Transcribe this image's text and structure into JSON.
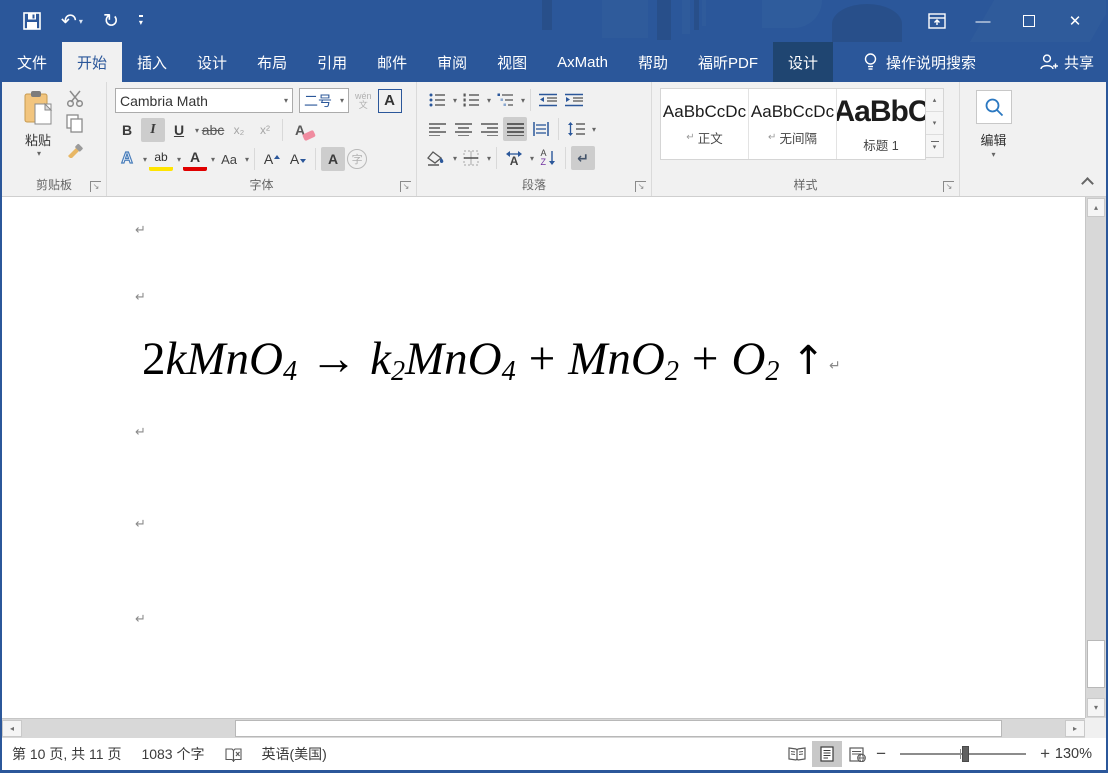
{
  "ui": {
    "arrow_down": "▾",
    "arrow_up": "▴",
    "arrow_left": "◂",
    "arrow_right": "▸",
    "launcher_arrow": "↘",
    "pilcrow": "↵",
    "undo_glyph": "↶",
    "redo_glyph": "↻",
    "minimize_glyph": "—",
    "close_glyph": "✕"
  },
  "icons": {
    "save": "floppy-disk",
    "undo": "curved-arrow-left",
    "redo": "circular-arrow",
    "qat_more": "customize-quick-access-toolbar",
    "ribbon_display": "window-with-up-arrow",
    "lightbulb": "tell-me-bulb",
    "share_person": "person-plus",
    "paste": "clipboard",
    "cut": "scissors",
    "copy": "two-pages",
    "format_painter": "brush",
    "search": "magnifier",
    "proofing": "book-with-x",
    "read_mode": "open-book",
    "print_layout": "page-with-lines",
    "web_layout": "page-with-globe"
  },
  "tabs": {
    "file": "文件",
    "items": [
      "开始",
      "插入",
      "设计",
      "布局",
      "引用",
      "邮件",
      "审阅",
      "视图",
      "AxMath",
      "帮助",
      "福昕PDF",
      "设计"
    ],
    "tell_me": "操作说明搜索",
    "share": "共享"
  },
  "ribbon": {
    "clipboard": {
      "paste": "粘贴",
      "group": "剪贴板"
    },
    "font": {
      "group": "字体",
      "name": "Cambria Math",
      "size": "二号",
      "bold": "B",
      "italic": "I",
      "underline": "U",
      "strike": "abc",
      "subscript": "x₂",
      "superscript": "x²",
      "phonetic_top": "wén",
      "phonetic_bottom": "文",
      "char_border": "A",
      "effects": "A",
      "highlight": "ab",
      "color": "A",
      "case": "Aa",
      "grow": "A",
      "shrink": "A",
      "shading": "A",
      "enclose": "字",
      "clear": "A"
    },
    "paragraph": {
      "group": "段落",
      "sort_a": "A",
      "sort_z": "Z",
      "asian_a": "A",
      "show_hide": "↵"
    },
    "styles": {
      "group": "样式",
      "cards": [
        {
          "sample": "AaBbCcDc",
          "label": "正文"
        },
        {
          "sample": "AaBbCcDc",
          "label": "无间隔"
        },
        {
          "sample": "AaBbC",
          "label": "标题 1"
        }
      ]
    },
    "editing": {
      "label": "编辑"
    }
  },
  "doc": {
    "equation": [
      "2",
      "kMnO",
      "4",
      "→",
      "k",
      "2",
      "MnO",
      "4",
      "+",
      "MnO",
      "2",
      "+",
      "O",
      "2",
      "↑"
    ]
  },
  "statusbar": {
    "page": "第 10 页, 共 11 页",
    "words": "1083 个字",
    "language": "英语(美国)",
    "zoom_out": "−",
    "zoom_in": "+",
    "zoom_level": "130%"
  }
}
